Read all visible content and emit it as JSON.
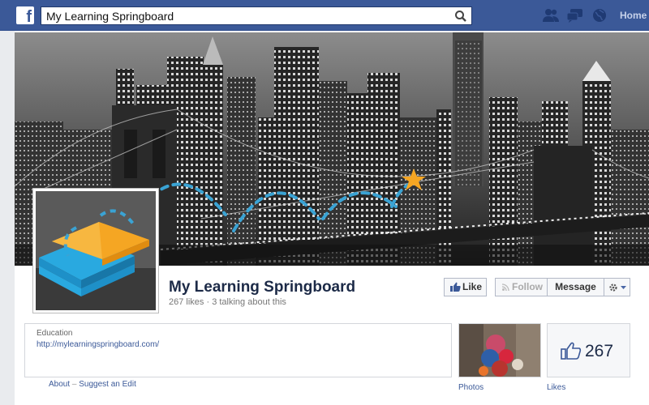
{
  "topbar": {
    "logo": "f",
    "search_value": "My Learning Springboard",
    "icons": [
      "friend-requests-icon",
      "messages-icon",
      "notifications-icon"
    ],
    "home_label": "Home"
  },
  "page": {
    "title": "My Learning Springboard",
    "stats": "267 likes · 3 talking about this"
  },
  "actions": {
    "like_label": "Like",
    "follow_label": "Follow",
    "message_label": "Message"
  },
  "about": {
    "category": "Education",
    "url": "http://mylearningspringboard.com/",
    "about_link": "About",
    "separator": "–",
    "suggest_edit_link": "Suggest an Edit"
  },
  "photos": {
    "label": "Photos"
  },
  "likes": {
    "count": "267",
    "label": "Likes"
  },
  "colors": {
    "brand_blue": "#3b5998",
    "star": "#f6a623",
    "dash": "#3aa3d4",
    "book_orange": "#f5a623",
    "book_blue": "#29a9e0"
  }
}
